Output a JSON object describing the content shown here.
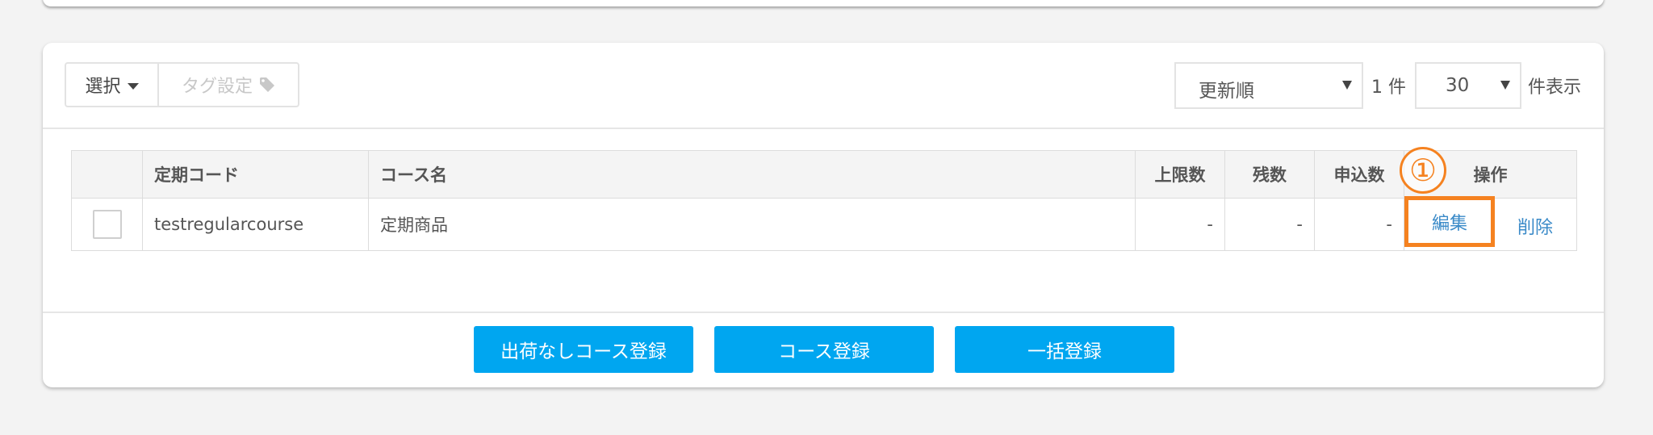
{
  "toolbar": {
    "select_label": "選択",
    "tag_label": "タグ設定"
  },
  "sort": {
    "selected": "更新順"
  },
  "count_text": "1 件",
  "per_page": {
    "selected": "30",
    "suffix": "件表示"
  },
  "table": {
    "headers": [
      "",
      "定期コード",
      "コース名",
      "上限数",
      "残数",
      "申込数",
      "操作"
    ],
    "rows": [
      {
        "code": "testregularcourse",
        "name": "定期商品",
        "limit": "-",
        "remaining": "-",
        "applied": "-",
        "edit": "編集",
        "delete": "削除"
      }
    ]
  },
  "annotation": "①",
  "buttons": {
    "no_shipping": "出荷なしコース登録",
    "course_register": "コース登録",
    "bulk_register": "一括登録"
  },
  "colors": {
    "accent_blue": "#00a6f0",
    "link_blue": "#3a8ac8",
    "highlight_orange": "#f58220"
  }
}
